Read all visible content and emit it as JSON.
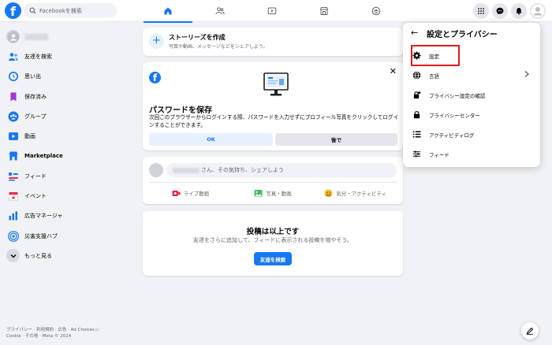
{
  "colors": {
    "brand": "#1877f2",
    "highlight": "#e0191e",
    "background": "#f0f2f5"
  },
  "topbar": {
    "logo": "f",
    "search_placeholder": "Facebookを検索",
    "icons": [
      "home-icon",
      "friends-icon",
      "video-icon",
      "marketplace-icon",
      "groups-icon"
    ],
    "right_icons": [
      "menu-grid-icon",
      "messenger-icon",
      "notifications-icon",
      "profile-avatar"
    ]
  },
  "sidebar": {
    "items": [
      {
        "label": "友達を検索",
        "icon": "friends-icon"
      },
      {
        "label": "思い出",
        "icon": "memories-icon"
      },
      {
        "label": "保存済み",
        "icon": "saved-icon"
      },
      {
        "label": "グループ",
        "icon": "groups-icon"
      },
      {
        "label": "動画",
        "icon": "video-icon"
      },
      {
        "label": "Marketplace",
        "icon": "marketplace-icon"
      },
      {
        "label": "フィード",
        "icon": "feed-icon"
      },
      {
        "label": "イベント",
        "icon": "events-icon"
      },
      {
        "label": "広告マネージャ",
        "icon": "ads-manager-icon"
      },
      {
        "label": "災害支援ハブ",
        "icon": "crisis-response-icon"
      },
      {
        "label": "もっと見る",
        "icon": "chevron-down-icon"
      }
    ]
  },
  "footer": {
    "line1": "プライバシー · 利用規約 · 広告 · Ad Choices ▷",
    "line2": "Cookie · その他 · Meta © 2024"
  },
  "stories": {
    "title": "ストーリーズを作成",
    "subtitle": "写真や動画、メッセージなどをシェアしよう。",
    "plus": "+"
  },
  "password_prompt": {
    "title": "パスワードを保存",
    "body": "次回このブラウザーからログインする際、パスワードを入力せずにプロフィール写真をクリックしてログインすることができます。",
    "ok_label": "OK",
    "later_label": "後で",
    "close": "✕"
  },
  "composer": {
    "prompt": "さん、その気持ち、シェアしよう",
    "actions": [
      {
        "label": "ライブ動画",
        "icon": "live-video-icon",
        "color": "#e42645"
      },
      {
        "label": "写真・動画",
        "icon": "photo-icon",
        "color": "#45bd62"
      },
      {
        "label": "気分・アクティビティ",
        "icon": "feeling-icon",
        "color": "#f7b928"
      }
    ]
  },
  "end_of_feed": {
    "title": "投稿は以上です",
    "subtitle": "友達をさらに追加して、フィードに表示される投稿を増やそう。",
    "button_label": "友達を検索"
  },
  "settings_menu": {
    "back": "←",
    "title": "設定とプライバシー",
    "items": [
      {
        "label": "設定",
        "icon": "gear-icon",
        "highlighted": true
      },
      {
        "label": "言語",
        "icon": "globe-icon",
        "has_chevron": true
      },
      {
        "label": "プライバシー設定の確認",
        "icon": "lock-check-icon"
      },
      {
        "label": "プライバシーセンター",
        "icon": "lock-icon"
      },
      {
        "label": "アクティビティログ",
        "icon": "list-icon"
      },
      {
        "label": "フィード",
        "icon": "sliders-icon"
      }
    ]
  }
}
